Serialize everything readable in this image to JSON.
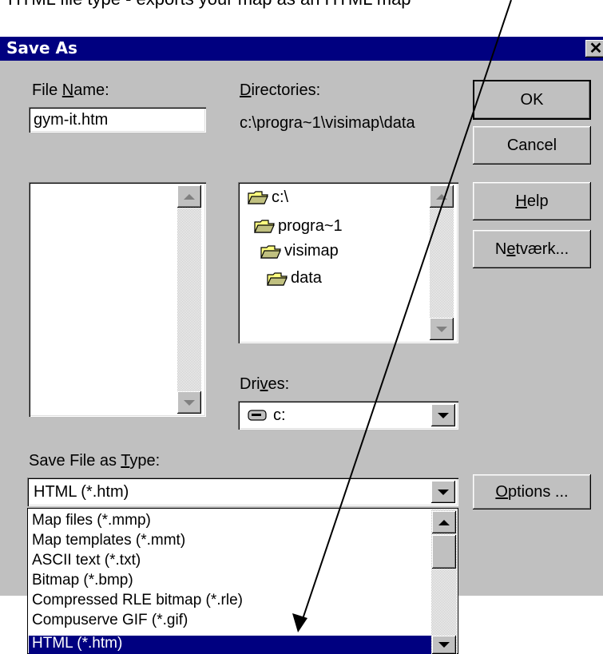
{
  "annotation": {
    "caption": "HTML file type - exports your map as an HTML map"
  },
  "dialog": {
    "title": "Save As",
    "close_label": "✕"
  },
  "file_name": {
    "label_pre": "File ",
    "label_u": "N",
    "label_post": "ame:",
    "value": "gym-it.htm"
  },
  "directories": {
    "label_u": "D",
    "label_post": "irectories:",
    "path": "c:\\progra~1\\visimap\\data",
    "tree": [
      "c:\\",
      "progra~1",
      "visimap",
      "data"
    ]
  },
  "drives": {
    "label_pre": "Dri",
    "label_u": "v",
    "label_post": "es:",
    "selected": "c:"
  },
  "buttons": {
    "ok": "OK",
    "cancel": "Cancel",
    "help_u": "H",
    "help_post": "elp",
    "network_pre": "N",
    "network_u": "e",
    "network_post": "tværk...",
    "options_u": "O",
    "options_post": "ptions ..."
  },
  "file_type": {
    "label_pre": "Save File as ",
    "label_u": "T",
    "label_post": "ype:",
    "selected": "HTML (*.htm)",
    "options": [
      "Map files (*.mmp)",
      "Map templates (*.mmt)",
      "ASCII text (*.txt)",
      "Bitmap (*.bmp)",
      "Compressed RLE bitmap (*.rle)",
      "Compuserve GIF (*.gif)",
      "HTML (*.htm)"
    ],
    "selected_index": 6
  },
  "colors": {
    "titlebar": "#000080",
    "face": "#c0c0c0",
    "highlight": "#000080"
  }
}
